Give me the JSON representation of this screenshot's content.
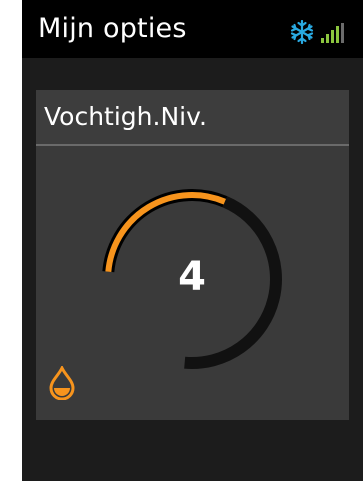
{
  "header": {
    "title": "Mijn opties",
    "icons": {
      "mode": "snowflake-icon",
      "signal": "signal-strength-icon"
    },
    "signal_level": 0.8
  },
  "setting": {
    "title": "Vochtigh.Niv.",
    "value": "4",
    "level_fraction": 0.4,
    "icon": "water-drop-icon"
  },
  "colors": {
    "accent": "#f7941d",
    "snowflake": "#29a9e1",
    "signal": "#8cc63f",
    "track": "#111111",
    "background": "#1c1c1c",
    "card": "#3a3a3a"
  }
}
